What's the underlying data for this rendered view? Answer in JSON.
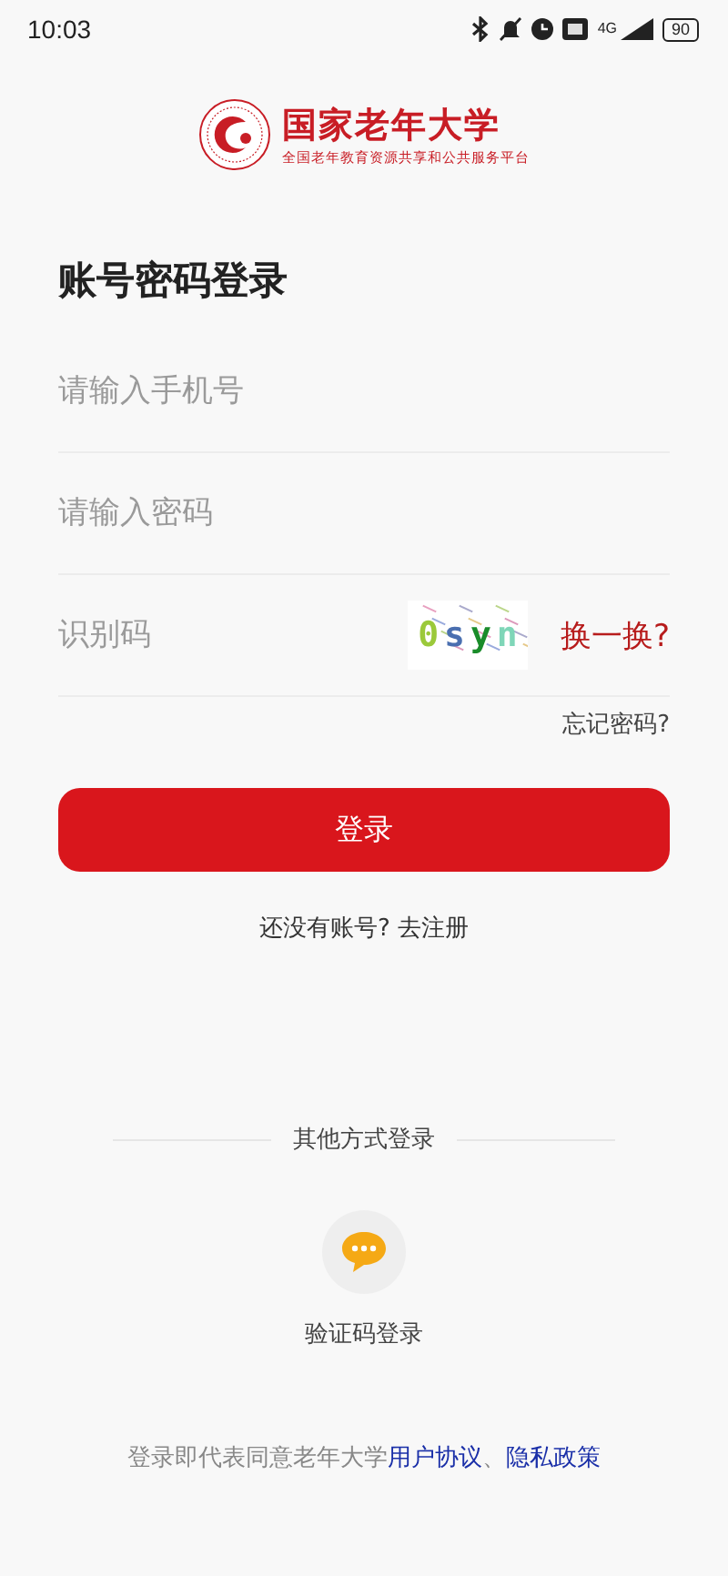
{
  "status_bar": {
    "time": "10:03",
    "network": "4G",
    "battery": "90"
  },
  "brand": {
    "title": "国家老年大学",
    "subtitle": "全国老年教育资源共享和公共服务平台"
  },
  "heading": "账号密码登录",
  "fields": [
    {
      "kind": "text",
      "placeholder": "请输入手机号"
    },
    {
      "kind": "password",
      "placeholder": "请输入密码"
    },
    {
      "kind": "captcha",
      "placeholder": "识别码",
      "captcha": "0syn",
      "refresh": "换一换?"
    }
  ],
  "forgot": "忘记密码?",
  "login_button": "登录",
  "register": "还没有账号? 去注册",
  "other_title": "其他方式登录",
  "other_methods": [
    {
      "label": "验证码登录"
    }
  ],
  "agreement": {
    "text": "登录即代表同意老年大学",
    "links": [
      "用户协议",
      "隐私政策"
    ],
    "separator": "、"
  }
}
